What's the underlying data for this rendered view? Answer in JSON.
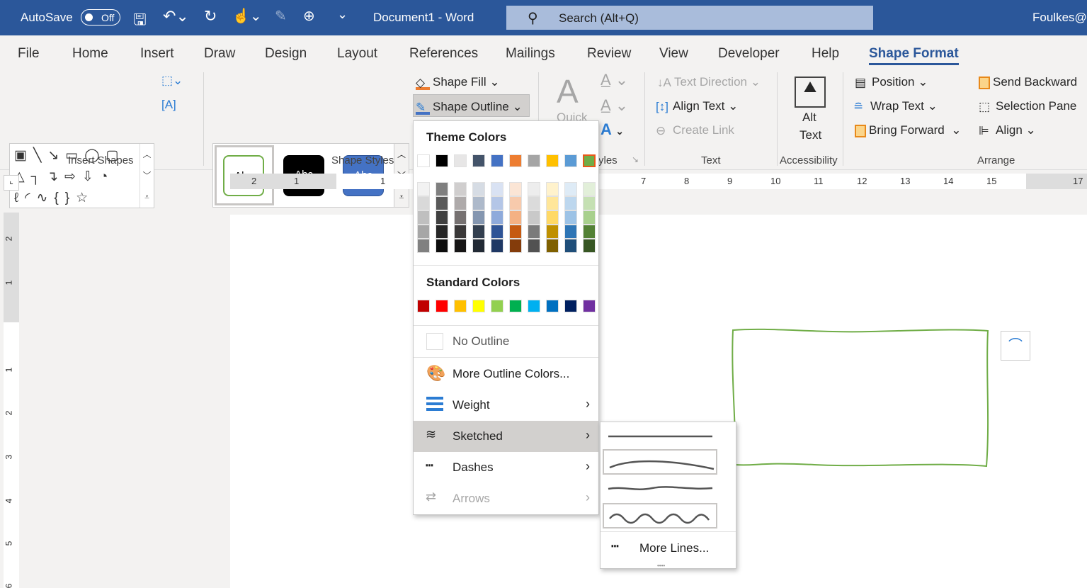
{
  "titlebar": {
    "autosave": "AutoSave",
    "toggle": "Off",
    "doc_title": "Document1  -  Word",
    "search": "Search (Alt+Q)",
    "user": "Foulkes@"
  },
  "tabs": [
    "File",
    "Home",
    "Insert",
    "Draw",
    "Design",
    "Layout",
    "References",
    "Mailings",
    "Review",
    "View",
    "Developer",
    "Help",
    "Shape Format"
  ],
  "active_tab": "Shape Format",
  "ribbon": {
    "insert_shapes": "Insert Shapes",
    "shape_styles": "Shape Styles",
    "style_sample": "Abc",
    "shape_fill": "Shape Fill",
    "shape_outline": "Shape Outline",
    "quick": "Quick",
    "wordart_styles_partial": "yles",
    "text_direction": "Text Direction",
    "align_text": "Align Text",
    "create_link": "Create Link",
    "text_group": "Text",
    "alt": "Alt",
    "alt_text": "Text",
    "accessibility": "Accessibility",
    "position": "Position",
    "wrap_text": "Wrap Text",
    "bring_forward": "Bring Forward",
    "send_backward": "Send Backward",
    "selection_pane": "Selection Pane",
    "align": "Align",
    "arrange": "Arrange"
  },
  "ruler": {
    "h": [
      "2",
      "1",
      "1",
      "7",
      "8",
      "9",
      "10",
      "11",
      "12",
      "13",
      "14",
      "15",
      "17"
    ],
    "v": [
      "2",
      "1",
      "1",
      "2",
      "3",
      "4",
      "5",
      "6"
    ]
  },
  "menu": {
    "theme_colors": "Theme Colors",
    "theme_top": [
      "#ffffff",
      "#000000",
      "#e7e6e6",
      "#44546a",
      "#4472c4",
      "#ed7d31",
      "#a5a5a5",
      "#ffc000",
      "#5b9bd5",
      "#70ad47"
    ],
    "theme_shades": [
      [
        "#f2f2f2",
        "#d9d9d9",
        "#bfbfbf",
        "#a6a6a6",
        "#808080"
      ],
      [
        "#7f7f7f",
        "#595959",
        "#404040",
        "#262626",
        "#0d0d0d"
      ],
      [
        "#d0cece",
        "#aeaaaa",
        "#767171",
        "#3a3838",
        "#171616"
      ],
      [
        "#d6dce4",
        "#adb9ca",
        "#8496b0",
        "#333f4f",
        "#222a35"
      ],
      [
        "#d9e2f3",
        "#b4c6e7",
        "#8eaadb",
        "#2f5496",
        "#1f3864"
      ],
      [
        "#fbe5d5",
        "#f7caac",
        "#f4b183",
        "#c55a11",
        "#843c0b"
      ],
      [
        "#ededed",
        "#dbdbdb",
        "#c9c9c9",
        "#7b7b7b",
        "#525252"
      ],
      [
        "#fff2cc",
        "#ffe699",
        "#ffd966",
        "#bf9000",
        "#7f6000"
      ],
      [
        "#deebf6",
        "#bdd7ee",
        "#9dc3e6",
        "#2e75b5",
        "#1f4e79"
      ],
      [
        "#e2efd9",
        "#c5e0b3",
        "#a8d08d",
        "#538135",
        "#375623"
      ]
    ],
    "selected_color": "#70ad47",
    "standard_colors": "Standard Colors",
    "standard": [
      "#c00000",
      "#ff0000",
      "#ffc000",
      "#ffff00",
      "#92d050",
      "#00b050",
      "#00b0f0",
      "#0070c0",
      "#002060",
      "#7030a0"
    ],
    "items": [
      {
        "label": "No Outline",
        "icon": "no-outline-icon"
      },
      {
        "label": "More Outline Colors...",
        "icon": "palette-icon"
      },
      {
        "label": "Weight",
        "icon": "weight-icon"
      },
      {
        "label": "Sketched",
        "icon": "sketched-icon"
      },
      {
        "label": "Dashes",
        "icon": "dashes-icon"
      },
      {
        "label": "Arrows",
        "icon": "arrows-icon"
      }
    ],
    "submenu_more": "More Lines..."
  },
  "colors": {
    "title_bar": "#2b579a",
    "shape_outline": "#70ad47"
  }
}
